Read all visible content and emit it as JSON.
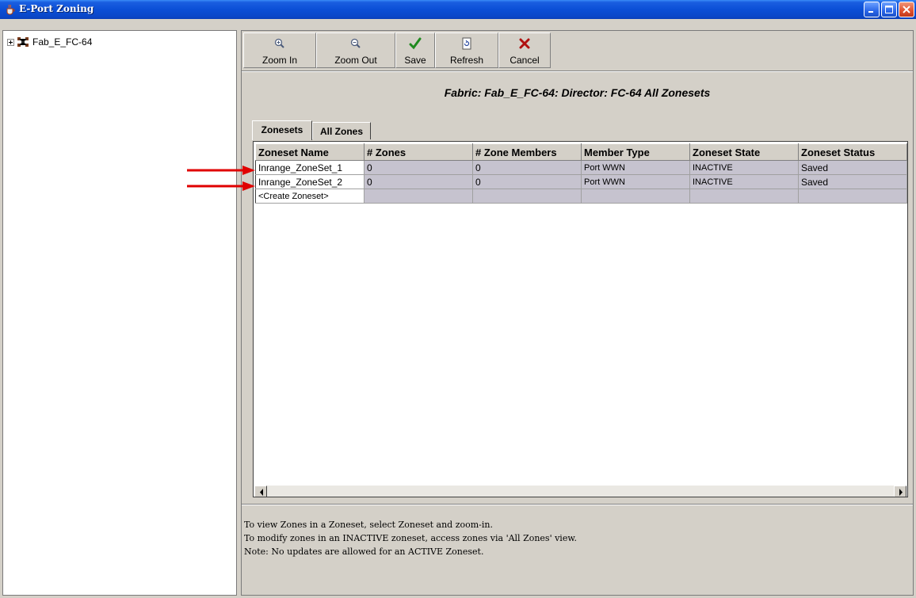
{
  "window": {
    "title": "E-Port Zoning",
    "title_icon": "java-cup-icon",
    "controls": [
      "minimize",
      "maximize",
      "close"
    ]
  },
  "tree": {
    "root_label": "Fab_E_FC-64",
    "root_icon": "fabric-icon",
    "expanded": false
  },
  "toolbar": {
    "buttons": [
      {
        "label": "Zoom In",
        "icon": "zoom-in-icon"
      },
      {
        "label": "Zoom Out",
        "icon": "zoom-out-icon"
      },
      {
        "label": "Save",
        "icon": "check-icon"
      },
      {
        "label": "Refresh",
        "icon": "refresh-icon"
      },
      {
        "label": "Cancel",
        "icon": "x-icon"
      }
    ]
  },
  "header": {
    "title": "Fabric: Fab_E_FC-64: Director: FC-64 All Zonesets"
  },
  "tabs": [
    {
      "label": "Zonesets",
      "active": true
    },
    {
      "label": "All Zones",
      "active": false
    }
  ],
  "table": {
    "columns": [
      "Zoneset Name",
      "# Zones",
      "# Zone Members",
      "Member Type",
      "Zoneset State",
      "Zoneset Status"
    ],
    "rows": [
      [
        "Inrange_ZoneSet_1",
        "0",
        "0",
        "Port WWN",
        "INACTIVE",
        "Saved"
      ],
      [
        "Inrange_ZoneSet_2",
        "0",
        "0",
        "Port WWN",
        "INACTIVE",
        "Saved"
      ],
      [
        "<Create Zoneset>",
        "",
        "",
        "",
        "",
        ""
      ]
    ]
  },
  "messages": [
    "To view Zones in a Zoneset, select Zoneset and zoom-in.",
    "To modify zones in an INACTIVE zoneset, access zones via 'All Zones' view.",
    "Note: No updates are allowed for an ACTIVE Zoneset."
  ],
  "colors": {
    "annotation_arrow": "#e00000",
    "titlebar": "#0b4fd6",
    "panel_bg": "#d4d0c8",
    "row_bg": "#c6c3cf"
  }
}
